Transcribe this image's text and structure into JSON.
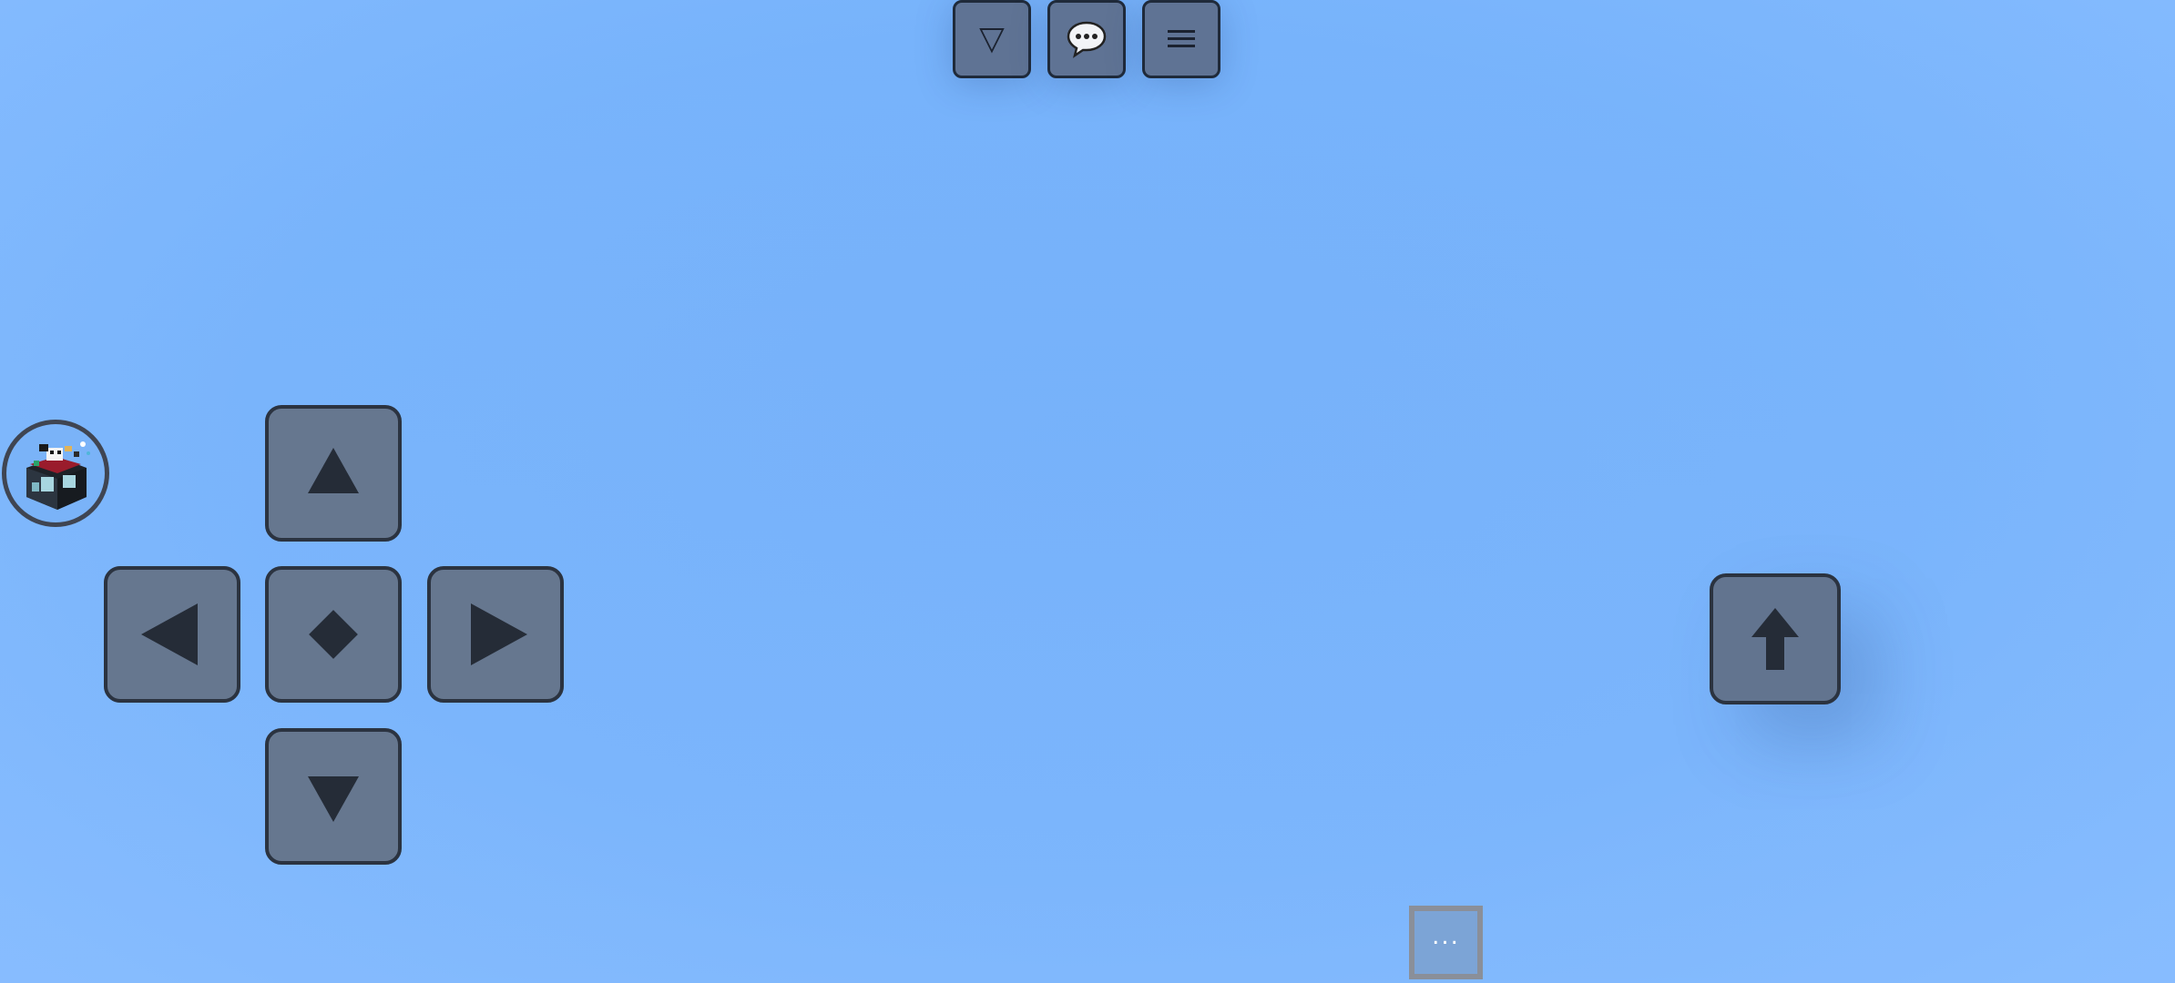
{
  "top_bar": {
    "toggle_glyph": "▽",
    "toggle_icon": "triangle-down-outline-icon",
    "chat_glyph": "💬",
    "chat_icon": "chat-bubble-icon",
    "menu_icon": "hamburger-menu-icon"
  },
  "player": {
    "avatar_icon": "player-avatar-icon"
  },
  "dpad": {
    "up_icon": "triangle-up-icon",
    "left_icon": "triangle-left-icon",
    "center_icon": "diamond-icon",
    "right_icon": "triangle-right-icon",
    "down_icon": "triangle-down-icon"
  },
  "jump": {
    "icon": "arrow-up-icon"
  },
  "more": {
    "label": "..."
  },
  "colors": {
    "sky": "#77b3fb",
    "button_fill": "#66778f",
    "button_border": "#2b3340",
    "glyph": "#252c37"
  }
}
